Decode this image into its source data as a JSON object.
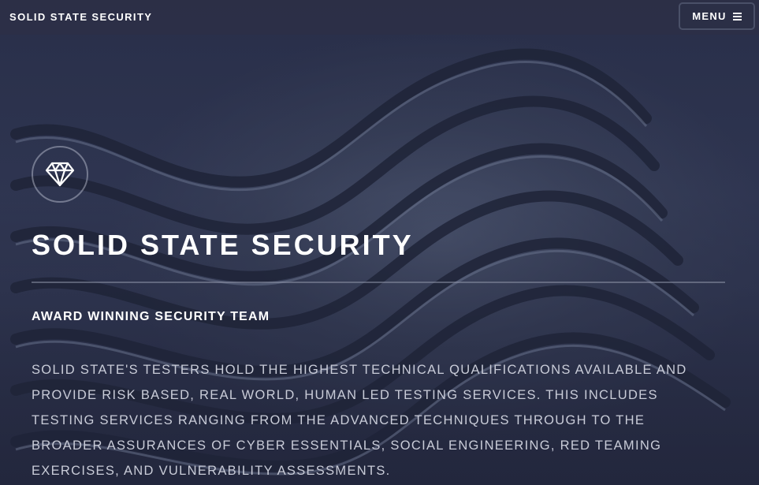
{
  "header": {
    "brand": "SOLID STATE SECURITY",
    "menu_label": "MENU",
    "menu_icon": "hamburger-icon"
  },
  "hero": {
    "icon": "diamond-icon",
    "title": "SOLID STATE SECURITY",
    "subtitle": "AWARD WINNING SECURITY TEAM",
    "body": "SOLID STATE'S TESTERS HOLD THE HIGHEST TECHNICAL QUALIFICATIONS AVAILABLE AND PROVIDE RISK BASED, REAL WORLD, HUMAN LED TESTING SERVICES. THIS INCLUDES TESTING SERVICES RANGING FROM THE ADVANCED TECHNIQUES THROUGH TO THE BROADER ASSURANCES OF CYBER ESSENTIALS, SOCIAL ENGINEERING, RED TEAMING EXERCISES, AND VULNERABILITY ASSESSMENTS."
  },
  "colors": {
    "header_bg": "#2c3046",
    "overlay": "#2e3450",
    "text_primary": "#ffffff",
    "text_body": "#c9ccd8"
  }
}
